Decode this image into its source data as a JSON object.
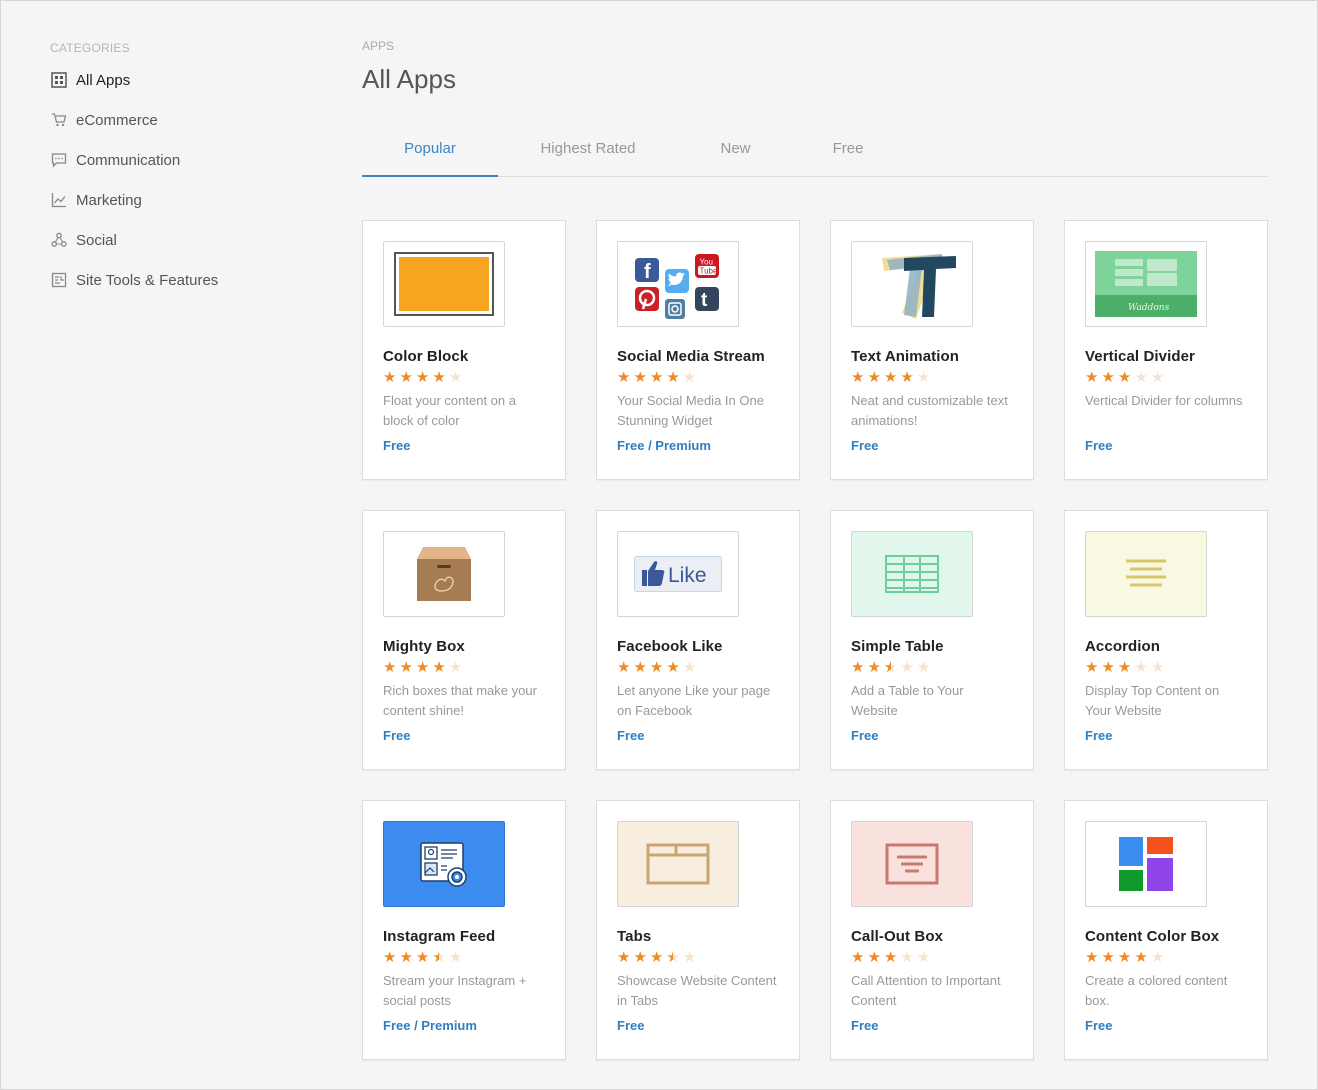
{
  "sidebar": {
    "heading": "CATEGORIES",
    "items": [
      {
        "label": "All Apps",
        "icon": "grid-icon"
      },
      {
        "label": "eCommerce",
        "icon": "cart-icon"
      },
      {
        "label": "Communication",
        "icon": "chat-icon"
      },
      {
        "label": "Marketing",
        "icon": "chart-icon"
      },
      {
        "label": "Social",
        "icon": "share-icon"
      },
      {
        "label": "Site Tools & Features",
        "icon": "tools-icon"
      }
    ]
  },
  "main": {
    "breadcrumb": "APPS",
    "title": "All Apps",
    "tabs": [
      "Popular",
      "Highest Rated",
      "New",
      "Free"
    ]
  },
  "apps": [
    {
      "title": "Color Block",
      "rating": 4,
      "desc": "Float your content on a block of color",
      "price": "Free",
      "icon": "color-block-thumbnail"
    },
    {
      "title": "Social Media Stream",
      "rating": 4,
      "desc": "Your Social Media In One Stunning Widget",
      "price": "Free / Premium",
      "icon": "social-media-thumbnail"
    },
    {
      "title": "Text Animation",
      "rating": 4,
      "desc": "Neat and customizable text animations!",
      "price": "Free",
      "icon": "text-animation-thumbnail"
    },
    {
      "title": "Vertical Divider",
      "rating": 3,
      "desc": "Vertical Divider for columns",
      "price": "Free",
      "icon": "vertical-divider-thumbnail"
    },
    {
      "title": "Mighty Box",
      "rating": 4,
      "desc": "Rich boxes that make your content shine!",
      "price": "Free",
      "icon": "mighty-box-thumbnail"
    },
    {
      "title": "Facebook Like",
      "rating": 4,
      "desc": "Let anyone Like your page on Facebook",
      "price": "Free",
      "icon": "facebook-like-thumbnail"
    },
    {
      "title": "Simple Table",
      "rating": 2.5,
      "desc": "Add a Table to Your Website",
      "price": "Free",
      "icon": "simple-table-thumbnail"
    },
    {
      "title": "Accordion",
      "rating": 3,
      "desc": "Display Top Content on Your Website",
      "price": "Free",
      "icon": "accordion-thumbnail"
    },
    {
      "title": "Instagram Feed",
      "rating": 3.5,
      "desc": "Stream your Instagram + social posts",
      "price": "Free / Premium",
      "icon": "instagram-feed-thumbnail"
    },
    {
      "title": "Tabs",
      "rating": 3.5,
      "desc": "Showcase Website Content in Tabs",
      "price": "Free",
      "icon": "tabs-thumbnail"
    },
    {
      "title": "Call-Out Box",
      "rating": 3,
      "desc": "Call Attention to Important Content",
      "price": "Free",
      "icon": "call-out-box-thumbnail"
    },
    {
      "title": "Content Color Box",
      "rating": 4,
      "desc": "Create a colored content box.",
      "price": "Free",
      "icon": "content-color-box-thumbnail"
    }
  ],
  "thumb_texts": {
    "youtube_top": "You",
    "youtube_bottom": "Tube",
    "divider_script": "Waddons",
    "like": "Like"
  },
  "colors": {
    "accent": "#3a86c8",
    "price": "#2f7fc1",
    "star": "#f08a24",
    "star_off": "#f5e3d2"
  }
}
